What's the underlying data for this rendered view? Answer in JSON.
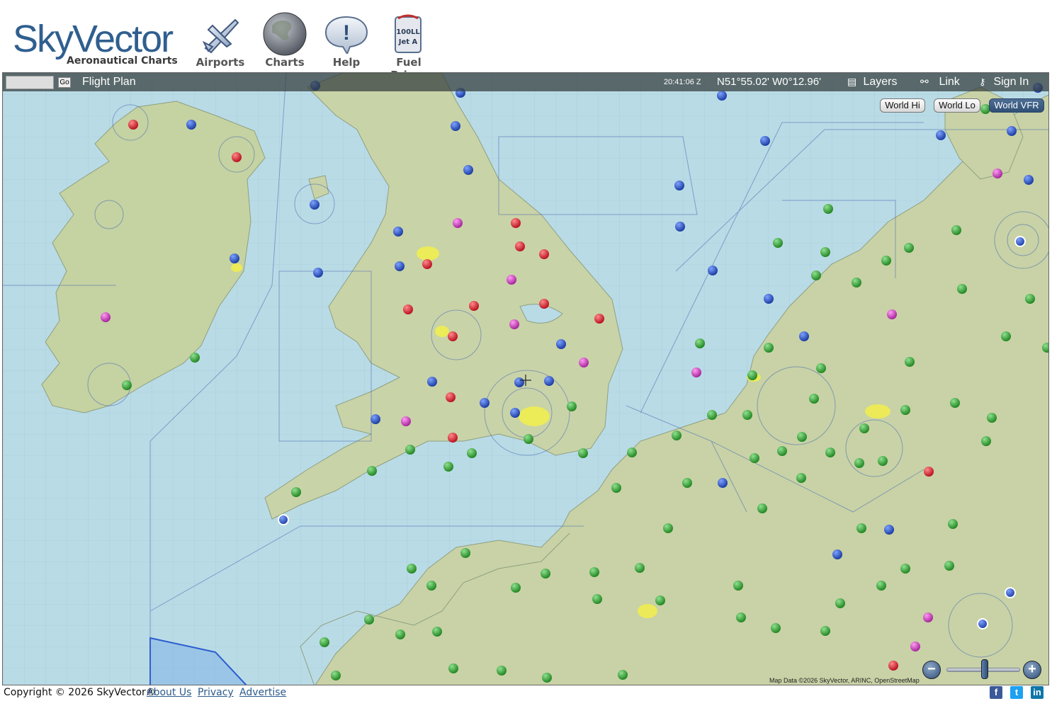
{
  "brand": {
    "name": "SkyVector",
    "tagline": "Aeronautical Charts"
  },
  "nav": [
    {
      "label": "Airports",
      "icon": "airplane-icon"
    },
    {
      "label": "Charts",
      "icon": "globe-icon"
    },
    {
      "label": "Help",
      "icon": "help-bubble-icon"
    },
    {
      "label": "Fuel Prices",
      "icon": "fuel-pump-icon",
      "icon_text_1": "100LL",
      "icon_text_2": "Jet A"
    }
  ],
  "toolbar": {
    "search_value": "",
    "go_label": "Go",
    "flight_plan_label": "Flight Plan",
    "zulu_time": "20:41:06 Z",
    "coordinates": "N51°55.02' W0°12.96'",
    "layers_label": "Layers",
    "link_label": "Link",
    "signin_label": "Sign In"
  },
  "chart_types": [
    {
      "label": "World Hi",
      "active": false
    },
    {
      "label": "World Lo",
      "active": false
    },
    {
      "label": "World VFR",
      "active": true
    }
  ],
  "zoom": {
    "minus": "−",
    "plus": "+",
    "level_fraction": 0.52
  },
  "map_attribution": "Map Data ©2026 SkyVector, ARINC, OpenStreetMap",
  "footer": {
    "copyright": "Copyright © 2026 SkyVector®",
    "links": [
      "About Us",
      "Privacy",
      "Advertise"
    ],
    "social": [
      "facebook-icon",
      "twitter-icon",
      "linkedin-icon"
    ]
  },
  "colors": {
    "sea": "#b9dbe6",
    "land": "#c9d3a8",
    "airport_red": "#d9161b",
    "airport_blue": "#1c46b8",
    "airport_green": "#1f9b1f",
    "airport_magenta": "#c01fb0",
    "accent": "#2f5f8f"
  }
}
